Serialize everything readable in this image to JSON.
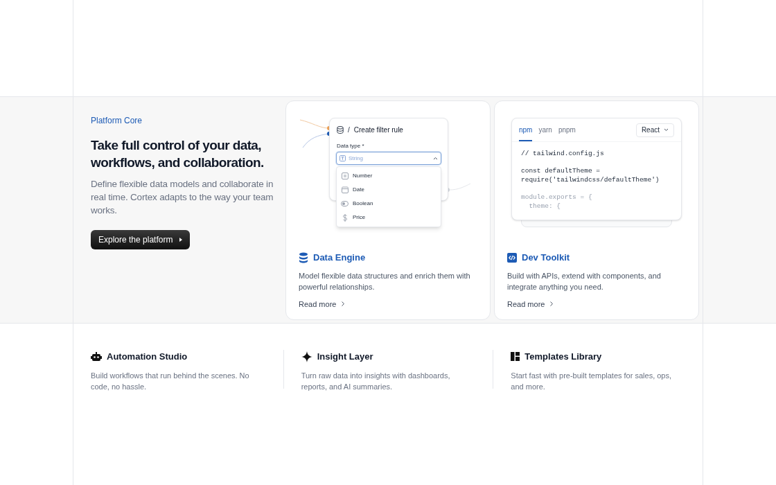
{
  "intro": {
    "eyebrow": "Platform Core",
    "heading": "Take full control of your data, workflows, and collaboration.",
    "body": "Define flexible data models and collaborate in real time. Cortex adapts to the way your team works.",
    "button": "Explore the platform"
  },
  "cards": [
    {
      "kind": "filter",
      "title": "Data Engine",
      "text": "Model flexible data structures and enrich them with powerful relationships.",
      "link": "Read more",
      "preview": {
        "separator": "/",
        "title": "Create filter rule",
        "field_label": "Data type *",
        "value": "String",
        "expanded": true,
        "options": [
          {
            "kind": "number",
            "label": "Number"
          },
          {
            "kind": "date",
            "label": "Date"
          },
          {
            "kind": "boolean",
            "label": "Boolean"
          },
          {
            "kind": "price",
            "label": "Price"
          }
        ]
      }
    },
    {
      "kind": "code",
      "title": "Dev Toolkit",
      "text": "Build with APIs, extend with components, and integrate anything you need.",
      "link": "Read more",
      "preview": {
        "tabs": [
          {
            "label": "npm",
            "selected": true
          },
          {
            "label": "yarn",
            "selected": false
          },
          {
            "label": "pnpm",
            "selected": false
          }
        ],
        "framework": "React",
        "blocks": [
          {
            "faded": false,
            "lines": [
              "// tailwind.config.js"
            ]
          },
          {
            "faded": false,
            "lines": [
              "const defaultTheme =",
              "require('tailwindcss/defaultTheme')"
            ]
          },
          {
            "faded": true,
            "lines": [
              "module.exports = {",
              "  theme: {"
            ]
          }
        ]
      }
    }
  ],
  "features": [
    {
      "title": "Automation Studio",
      "text": "Build workflows that run behind the scenes. No code, no hassle."
    },
    {
      "title": "Insight Layer",
      "text": "Turn raw data into insights with dashboards, reports, and AI summaries."
    },
    {
      "title": "Templates Library",
      "text": "Start fast with pre-built templates for sales, ops, and more."
    }
  ]
}
